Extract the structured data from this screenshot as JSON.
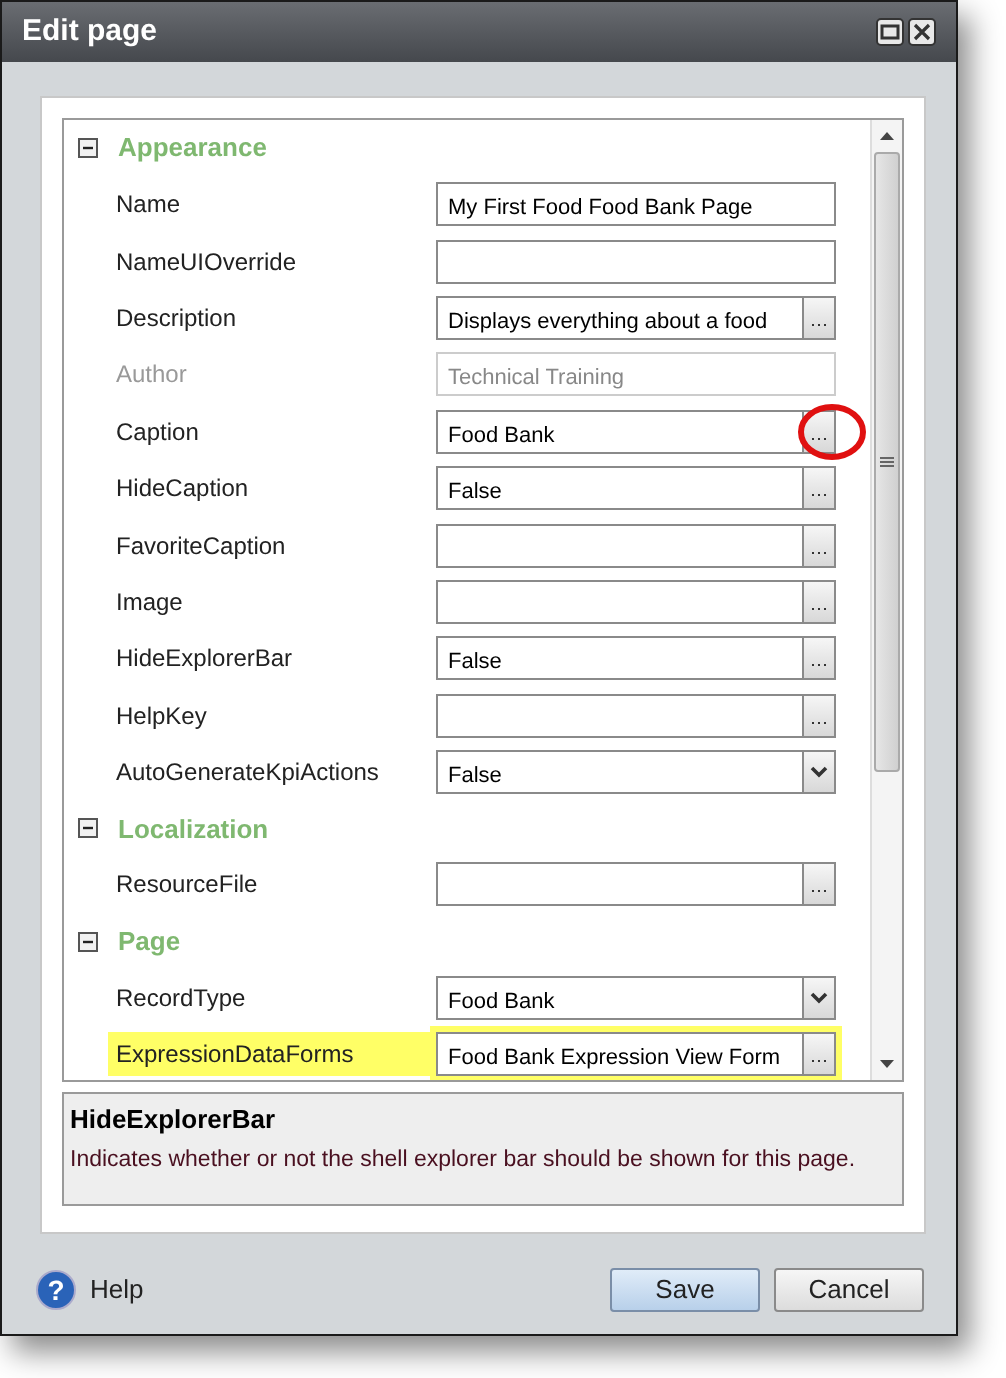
{
  "window": {
    "title": "Edit page"
  },
  "groups": [
    {
      "title": "Appearance",
      "expanded": true,
      "rows": [
        {
          "label": "Name",
          "kind": "text",
          "value": "My First Food Food Bank Page",
          "disabled": false,
          "highlighted": false,
          "circled": false
        },
        {
          "label": "NameUIOverride",
          "kind": "text",
          "disabled": false,
          "highlighted": false,
          "circled": false
        },
        {
          "label": "Description",
          "kind": "ellipsis",
          "value": "Displays everything about a food",
          "disabled": false,
          "highlighted": false,
          "circled": false
        },
        {
          "label": "Author",
          "kind": "text",
          "value": "Technical Training",
          "disabled": true,
          "highlighted": false,
          "circled": false
        },
        {
          "label": "Caption",
          "kind": "ellipsis",
          "value": "Food Bank",
          "disabled": false,
          "highlighted": false,
          "circled": true
        },
        {
          "label": "HideCaption",
          "kind": "ellipsis",
          "value": "False",
          "disabled": false,
          "highlighted": false,
          "circled": false
        },
        {
          "label": "FavoriteCaption",
          "kind": "ellipsis",
          "disabled": false,
          "highlighted": false,
          "circled": false
        },
        {
          "label": "Image",
          "kind": "ellipsis",
          "disabled": false,
          "highlighted": false,
          "circled": false
        },
        {
          "label": "HideExplorerBar",
          "kind": "ellipsis",
          "value": "False",
          "disabled": false,
          "highlighted": false,
          "circled": false
        },
        {
          "label": "HelpKey",
          "kind": "ellipsis",
          "disabled": false,
          "highlighted": false,
          "circled": false
        },
        {
          "label": "AutoGenerateKpiActions",
          "kind": "dropdown",
          "value": "False",
          "disabled": false,
          "highlighted": false,
          "circled": false
        }
      ]
    },
    {
      "title": "Localization",
      "expanded": true,
      "rows": [
        {
          "label": "ResourceFile",
          "kind": "ellipsis",
          "disabled": false,
          "highlighted": false,
          "circled": false
        }
      ]
    },
    {
      "title": "Page",
      "expanded": true,
      "rows": [
        {
          "label": "RecordType",
          "kind": "dropdown",
          "value": "Food Bank",
          "disabled": false,
          "highlighted": false,
          "circled": false
        },
        {
          "label": "ExpressionDataForms",
          "kind": "ellipsis",
          "value": "Food Bank Expression View Form",
          "disabled": false,
          "highlighted": true,
          "circled": false
        }
      ]
    }
  ],
  "description": {
    "title": "HideExplorerBar",
    "text": "Indicates whether or not the shell explorer bar should be shown for this page."
  },
  "footer": {
    "help_icon": "?",
    "help": "Help",
    "buttons": [
      {
        "label": "Save",
        "primary": true
      },
      {
        "label": "Cancel",
        "primary": false
      }
    ]
  }
}
